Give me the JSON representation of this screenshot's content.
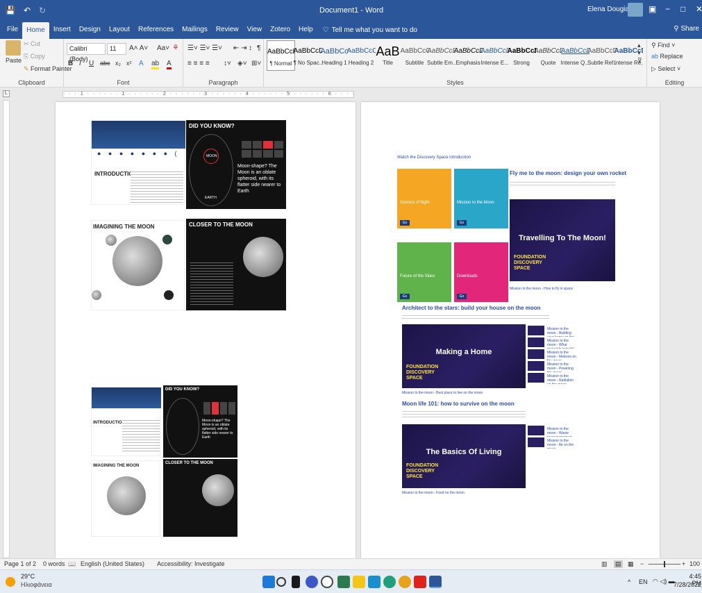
{
  "titlebar": {
    "title": "Document1 - Word",
    "user": "Elena Dougia",
    "quick_save": "💾",
    "quick_undo": "↶",
    "quick_redo": "↻",
    "win_min": "−",
    "win_restore": "□",
    "win_close": "✕"
  },
  "tabs": [
    "File",
    "Home",
    "Insert",
    "Design",
    "Layout",
    "References",
    "Mailings",
    "Review",
    "View",
    "Zotero",
    "Help"
  ],
  "tell_me": "Tell me what you want to do",
  "share": "Share",
  "clipboard": {
    "cut": "Cut",
    "copy": "Copy",
    "paste": "Paste",
    "format_painter": "Format Painter",
    "label": "Clipboard"
  },
  "font": {
    "name": "Calibri (Body)",
    "size": "11",
    "label": "Font"
  },
  "paragraph": {
    "label": "Paragraph"
  },
  "styles": {
    "label": "Styles",
    "items": [
      {
        "sample": "AaBbCcDc",
        "name": "¶ Normal"
      },
      {
        "sample": "AaBbCcDc",
        "name": "¶ No Spac..."
      },
      {
        "sample": "AaBbCc",
        "name": "Heading 1"
      },
      {
        "sample": "AaBbCcC",
        "name": "Heading 2"
      },
      {
        "sample": "AaB",
        "name": "Title"
      },
      {
        "sample": "AaBbCcC",
        "name": "Subtitle"
      },
      {
        "sample": "AaBbCcDc",
        "name": "Subtle Em..."
      },
      {
        "sample": "AaBbCcDc",
        "name": "Emphasis"
      },
      {
        "sample": "AaBbCcDc",
        "name": "Intense E..."
      },
      {
        "sample": "AaBbCcDc",
        "name": "Strong"
      },
      {
        "sample": "AaBbCcDc",
        "name": "Quote"
      },
      {
        "sample": "AaBbCcDc",
        "name": "Intense Q..."
      },
      {
        "sample": "AaBbCcDc",
        "name": "Subtle Ref..."
      },
      {
        "sample": "AaBbCcDc",
        "name": "Intense Re..."
      }
    ]
  },
  "editing": {
    "find": "Find",
    "replace": "Replace",
    "select": "Select",
    "label": "Editing"
  },
  "page1": {
    "did_you_know": "DID YOU KNOW?",
    "introduction": "INTRODUCTION",
    "moon_fact": "Moon-shape? The Moon is an oblate spheroid, with its flatter side nearer to Earth",
    "moon": "MOON",
    "earth": "EARTH",
    "imagining": "IMAGINING THE MOON",
    "closer": "CLOSER TO THE MOON"
  },
  "page2": {
    "watch_link": "Watch the Discovery Space introduction",
    "cards": [
      "Science of flight",
      "Mission to the Moon",
      "Future of the Skies",
      "Downloads"
    ],
    "rocket_title": "Fly me to the moon: design your own rocket",
    "video1_title": "Travelling To The Moon!",
    "video1_caption": "Mission to the moon - How to fly in space",
    "architect_title": "Architect to the stars: build your house on the moon",
    "video2_title": "Making a Home",
    "video2_caption": "Mission to the moon - Best place to live on the moon",
    "thumbs2": [
      "Mission to the moon - Building your home on the moon",
      "Mission to the moon - What materials to build your home on the moon",
      "Mission to the moon - Meteors on the moon",
      "Mission to the moon - Powering the moon",
      "Mission to the moon - Radiation on the moon"
    ],
    "moonlife_title": "Moon life 101: how to survive on the moon",
    "video3_title": "The Basics Of Living",
    "video3_caption": "Mission to the moon - Food on the moon",
    "thumbs3": [
      "Mission to the moon - Waste management on the moon",
      "Mission to the moon - Air on the moon"
    ],
    "brand1": "FOUNDATION",
    "brand2": "DISCOVERY",
    "brand3": "SPACE"
  },
  "status": {
    "page": "Page 1 of 2",
    "words": "0 words",
    "language": "English (United States)",
    "accessibility": "Accessibility: Investigate",
    "zoom": "100"
  },
  "taskbar": {
    "temp": "29°C",
    "weather": "Ηλιοφάνεια",
    "lang": "EN",
    "time": "4:45 PM",
    "date": "7/28/2022"
  }
}
